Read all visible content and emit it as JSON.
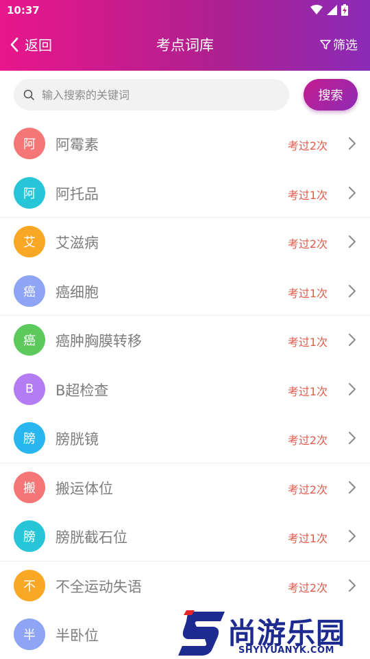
{
  "status_bar": {
    "time": "10:37",
    "icons": [
      "wifi-icon",
      "signal-icon",
      "battery-icon"
    ]
  },
  "nav": {
    "back_label": "返回",
    "title": "考点词库",
    "filter_label": "筛选"
  },
  "search": {
    "placeholder": "输入搜索的关键词",
    "value": "",
    "button_label": "搜索"
  },
  "colors": {
    "header_gradient": [
      "#e8168b",
      "#8a2bb6"
    ],
    "count_text": "#e25a4a",
    "term_text": "#7d7d7d"
  },
  "terms": [
    {
      "initial": "阿",
      "name": "阿霉素",
      "count": "考过2次",
      "color": "#f47676"
    },
    {
      "initial": "阿",
      "name": "阿托品",
      "count": "考过1次",
      "color": "#26c6d8"
    },
    {
      "initial": "艾",
      "name": "艾滋病",
      "count": "考过2次",
      "color": "#f9a825"
    },
    {
      "initial": "癌",
      "name": "癌细胞",
      "count": "考过1次",
      "color": "#8ea4f5"
    },
    {
      "initial": "癌",
      "name": "癌肿胸膜转移",
      "count": "考过1次",
      "color": "#5cc95c"
    },
    {
      "initial": "B",
      "name": "B超检查",
      "count": "考过1次",
      "color": "#b47cf2"
    },
    {
      "initial": "膀",
      "name": "膀胱镜",
      "count": "考过2次",
      "color": "#29b6ee"
    },
    {
      "initial": "搬",
      "name": "搬运体位",
      "count": "考过2次",
      "color": "#f47676"
    },
    {
      "initial": "膀",
      "name": "膀胱截石位",
      "count": "考过1次",
      "color": "#26c6d8"
    },
    {
      "initial": "不",
      "name": "不全运动失语",
      "count": "考过2次",
      "color": "#f9a825"
    },
    {
      "initial": "半",
      "name": "半卧位",
      "count": "",
      "color": "#8ea4f5"
    }
  ],
  "watermark": {
    "title": "尚游乐园",
    "subtitle": "SHYIYUANYK.COM"
  }
}
